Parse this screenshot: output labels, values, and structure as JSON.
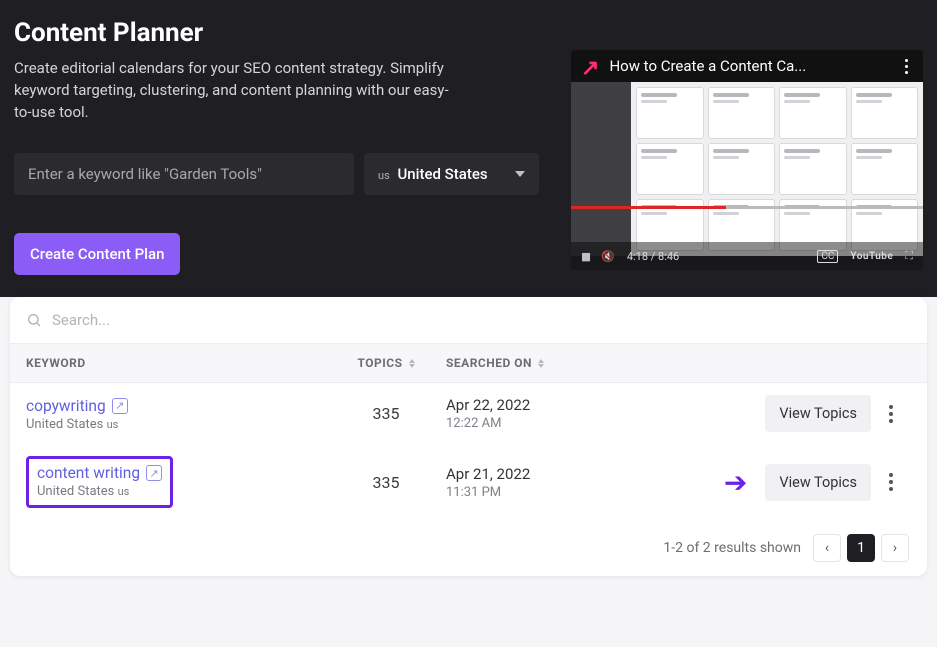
{
  "header": {
    "title": "Content Planner",
    "description": "Create editorial calendars for your SEO content strategy. Simplify keyword targeting, clustering, and content planning with our easy-to-use tool."
  },
  "input": {
    "placeholder": "Enter a keyword like \"Garden Tools\"",
    "country_code": "us",
    "country": "United States"
  },
  "cta": {
    "label": "Create Content Plan"
  },
  "video": {
    "title": "How to Create a Content Ca...",
    "time": "4:18 / 8:46",
    "cc": "CC",
    "brand": "YouTube"
  },
  "panel": {
    "search_placeholder": "Search...",
    "columns": {
      "keyword": "KEYWORD",
      "topics": "TOPICS",
      "searched_on": "SEARCHED ON"
    },
    "rows": [
      {
        "keyword": "copywriting",
        "location": "United States",
        "location_code": "us",
        "topics": "335",
        "date": "Apr 22, 2022",
        "time": "12:22 AM",
        "action": "View Topics",
        "highlight": false
      },
      {
        "keyword": "content writing",
        "location": "United States",
        "location_code": "us",
        "topics": "335",
        "date": "Apr 21, 2022",
        "time": "11:31 PM",
        "action": "View Topics",
        "highlight": true
      }
    ],
    "results_text": "1-2 of 2 results shown",
    "page": "1"
  }
}
